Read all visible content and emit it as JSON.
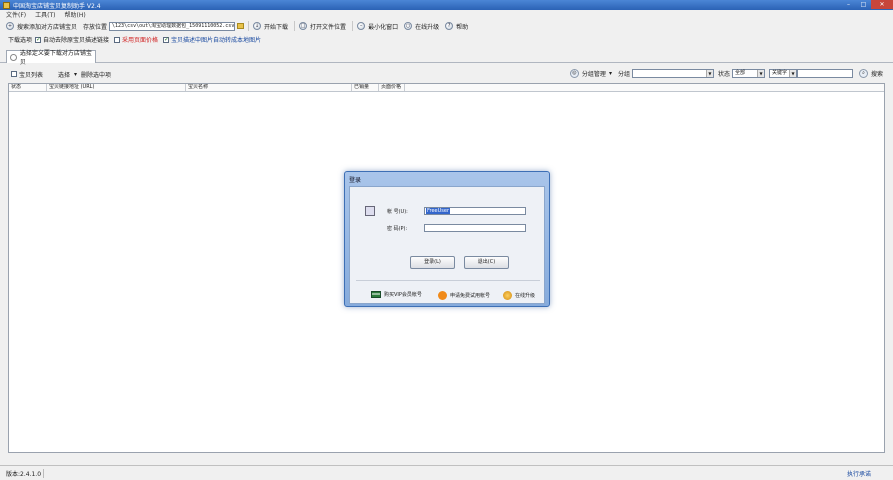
{
  "window": {
    "title": "中国淘宝店铺宝贝复制助手 V2.4",
    "controls": [
      "–",
      "□",
      "✕"
    ]
  },
  "menu": [
    "文件(F)",
    "工具(T)",
    "帮助(H)"
  ],
  "toolbar": {
    "batch_add_label": "搜索添加对方店铺宝贝",
    "save_location_label": "存放位置",
    "save_path_value": "\\123\\csv\\out\\淘宝助理数据包_15091110052.csv",
    "start_download_label": "开始下载",
    "open_location_label": "打开文件位置",
    "minimize_label": "最小化窗口",
    "online_upgrade_label": "在线升级",
    "help_label": "帮助"
  },
  "options": {
    "prefix": "下载选项",
    "items": [
      {
        "label": "自动去除原宝贝描述链接",
        "checked": true,
        "color": "#222222"
      },
      {
        "label": "采用页面价格",
        "checked": false,
        "color": "#d02020"
      },
      {
        "label": "宝贝描述中图片自动转成本地图片",
        "checked": true,
        "color": "#1a4aa0"
      }
    ]
  },
  "tabs": [
    {
      "label": "选择定义要下载对方店铺宝贝"
    }
  ],
  "listbar": {
    "list_checkbox_label": "宝贝列表",
    "select_label": "选择",
    "delete_label": "删除选中项",
    "group_manage_label": "分组管理",
    "group_label": "分组",
    "status_label": "状态",
    "status_value": "全部",
    "keyword_value": "关键字",
    "search_label": "搜索"
  },
  "table": {
    "columns": [
      "状态",
      "宝贝链接地址 (URL)",
      "宝贝名称",
      "已销量",
      "页面价格"
    ]
  },
  "status": {
    "version": "版本:2.4.1.0",
    "slogan": "执行承诺"
  },
  "login": {
    "title": "登录",
    "account_label": "帐  号(U):",
    "account_value": "FreeUser",
    "password_label": "密  码(P):",
    "password_value": "",
    "login_button": "登录(L)",
    "exit_button": "退出(C)",
    "buy_vip_label": "购买VIP会员帐号",
    "apply_trial_label": "申请免费试用帐号",
    "upgrade_label": "在线升级"
  },
  "colors": {
    "accent": "#2b62b5",
    "dialog_frame": "#86abdc"
  }
}
